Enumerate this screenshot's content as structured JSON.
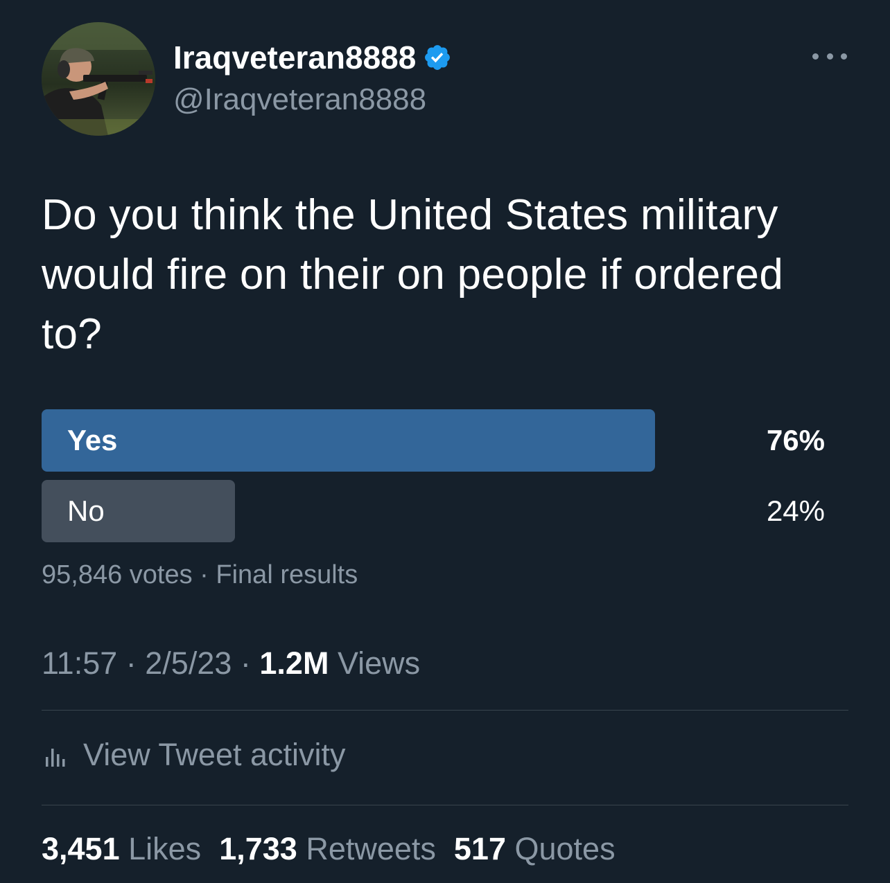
{
  "author": {
    "display_name": "Iraqveteran8888",
    "handle": "@Iraqveteran8888",
    "verified_icon": "verified-badge-icon",
    "avatar_icon": "profile-photo"
  },
  "tweet": {
    "text": "Do you think the United States military would fire on their on people if ordered to?"
  },
  "poll": {
    "options": [
      {
        "label": "Yes",
        "percent": "76%",
        "fill": 0.76,
        "winner": true
      },
      {
        "label": "No",
        "percent": "24%",
        "fill": 0.24,
        "winner": false
      }
    ],
    "votes": "95,846 votes",
    "separator": " · ",
    "status": "Final results",
    "colors": {
      "winner": "#336699",
      "other": "#444f5c"
    }
  },
  "meta": {
    "time": "11:57",
    "date": "2/5/23",
    "separator": " · ",
    "views_count": "1.2M",
    "views_label": " Views"
  },
  "activity": {
    "label": "View Tweet activity",
    "icon": "bar-chart-icon"
  },
  "stats": {
    "likes_count": "3,451",
    "likes_label": " Likes",
    "retweets_count": "1,733",
    "retweets_label": " Retweets",
    "quotes_count": "517",
    "quotes_label": " Quotes"
  },
  "theme": {
    "background": "#15202b",
    "secondary_text": "#8b98a5",
    "verified_blue": "#1d9bf0",
    "divider": "#38444d"
  }
}
